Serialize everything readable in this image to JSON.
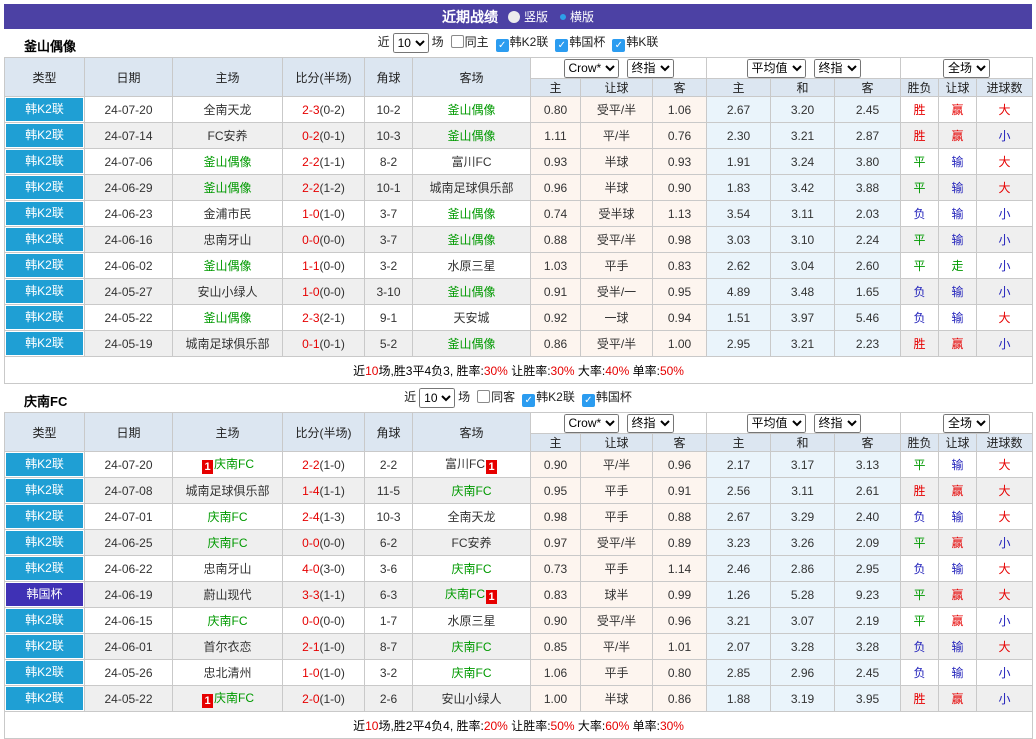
{
  "titlebar": {
    "title": "近期战绩",
    "radios": [
      {
        "label": "竖版",
        "selected": true
      },
      {
        "label": "横版",
        "selected": false
      }
    ]
  },
  "colors": {
    "titlebar_bg": "#4c41a4",
    "league_badge_bg": "#1f9fd4",
    "cup_badge_bg": "#3f31b5",
    "header_cell_bg": "#dce6f1",
    "handicap_cols_bg": "#fdf5ef",
    "average_cols_bg": "#eaf4fb",
    "score_red": "#e60000",
    "team_green": "#009a00",
    "win_red": "#e60000",
    "draw_green": "#009900",
    "lose_blue": "#2222bb"
  },
  "sections": [
    {
      "team": "釜山偶像",
      "filter": {
        "near_label": "近",
        "games_value": "10",
        "games_suffix": "场",
        "checkboxes": [
          {
            "label": "同主",
            "checked": false
          },
          {
            "label": "韩K2联",
            "checked": true
          },
          {
            "label": "韩国杯",
            "checked": true
          },
          {
            "label": "韩K联",
            "checked": true
          }
        ]
      },
      "header": {
        "left_cols": [
          "类型",
          "日期",
          "主场",
          "比分(半场)",
          "角球",
          "客场"
        ],
        "select_groups": [
          [
            "Crow*",
            "终指"
          ],
          [
            "平均值",
            "终指"
          ],
          [
            "全场"
          ]
        ],
        "sub_cols": [
          "主",
          "让球",
          "客",
          "主",
          "和",
          "客",
          "胜负",
          "让球",
          "进球数"
        ]
      },
      "rows": [
        {
          "type": "韩K2联",
          "style": "league",
          "date": "24-07-20",
          "home": {
            "text": "全南天龙"
          },
          "score": "2-3",
          "half": "(0-2)",
          "corner": "10-2",
          "away": {
            "text": "釜山偶像",
            "green": true
          },
          "odds": [
            "0.80",
            "受平/半",
            "1.06",
            "2.67",
            "3.20",
            "2.45"
          ],
          "results": [
            "胜",
            "赢",
            "大"
          ]
        },
        {
          "type": "韩K2联",
          "style": "league",
          "date": "24-07-14",
          "home": {
            "text": "FC安养"
          },
          "score": "0-2",
          "half": "(0-1)",
          "corner": "10-3",
          "away": {
            "text": "釜山偶像",
            "green": true
          },
          "odds": [
            "1.11",
            "平/半",
            "0.76",
            "2.30",
            "3.21",
            "2.87"
          ],
          "results": [
            "胜",
            "赢",
            "小"
          ]
        },
        {
          "type": "韩K2联",
          "style": "league",
          "date": "24-07-06",
          "home": {
            "text": "釜山偶像",
            "green": true
          },
          "score": "2-2",
          "half": "(1-1)",
          "corner": "8-2",
          "away": {
            "text": "富川FC"
          },
          "odds": [
            "0.93",
            "半球",
            "0.93",
            "1.91",
            "3.24",
            "3.80"
          ],
          "results": [
            "平",
            "输",
            "大"
          ]
        },
        {
          "type": "韩K2联",
          "style": "league",
          "date": "24-06-29",
          "home": {
            "text": "釜山偶像",
            "green": true
          },
          "score": "2-2",
          "half": "(1-2)",
          "corner": "10-1",
          "away": {
            "text": "城南足球俱乐部"
          },
          "odds": [
            "0.96",
            "半球",
            "0.90",
            "1.83",
            "3.42",
            "3.88"
          ],
          "results": [
            "平",
            "输",
            "大"
          ]
        },
        {
          "type": "韩K2联",
          "style": "league",
          "date": "24-06-23",
          "home": {
            "text": "金浦市民"
          },
          "score": "1-0",
          "half": "(1-0)",
          "corner": "3-7",
          "away": {
            "text": "釜山偶像",
            "green": true
          },
          "odds": [
            "0.74",
            "受半球",
            "1.13",
            "3.54",
            "3.11",
            "2.03"
          ],
          "results": [
            "负",
            "输",
            "小"
          ]
        },
        {
          "type": "韩K2联",
          "style": "league",
          "date": "24-06-16",
          "home": {
            "text": "忠南牙山"
          },
          "score": "0-0",
          "half": "(0-0)",
          "corner": "3-7",
          "away": {
            "text": "釜山偶像",
            "green": true
          },
          "odds": [
            "0.88",
            "受平/半",
            "0.98",
            "3.03",
            "3.10",
            "2.24"
          ],
          "results": [
            "平",
            "输",
            "小"
          ]
        },
        {
          "type": "韩K2联",
          "style": "league",
          "date": "24-06-02",
          "home": {
            "text": "釜山偶像",
            "green": true
          },
          "score": "1-1",
          "half": "(0-0)",
          "corner": "3-2",
          "away": {
            "text": "水原三星"
          },
          "odds": [
            "1.03",
            "平手",
            "0.83",
            "2.62",
            "3.04",
            "2.60"
          ],
          "results": [
            "平",
            "走",
            "小"
          ]
        },
        {
          "type": "韩K2联",
          "style": "league",
          "date": "24-05-27",
          "home": {
            "text": "安山小绿人"
          },
          "score": "1-0",
          "half": "(0-0)",
          "corner": "3-10",
          "away": {
            "text": "釜山偶像",
            "green": true
          },
          "odds": [
            "0.91",
            "受半/一",
            "0.95",
            "4.89",
            "3.48",
            "1.65"
          ],
          "results": [
            "负",
            "输",
            "小"
          ]
        },
        {
          "type": "韩K2联",
          "style": "league",
          "date": "24-05-22",
          "home": {
            "text": "釜山偶像",
            "green": true
          },
          "score": "2-3",
          "half": "(2-1)",
          "corner": "9-1",
          "away": {
            "text": "天安城"
          },
          "odds": [
            "0.92",
            "一球",
            "0.94",
            "1.51",
            "3.97",
            "5.46"
          ],
          "results": [
            "负",
            "输",
            "大"
          ]
        },
        {
          "type": "韩K2联",
          "style": "league",
          "date": "24-05-19",
          "home": {
            "text": "城南足球俱乐部"
          },
          "score": "0-1",
          "half": "(0-1)",
          "corner": "5-2",
          "away": {
            "text": "釜山偶像",
            "green": true
          },
          "odds": [
            "0.86",
            "受平/半",
            "1.00",
            "2.95",
            "3.21",
            "2.23"
          ],
          "results": [
            "胜",
            "赢",
            "小"
          ]
        }
      ],
      "summary": [
        {
          "t": "近"
        },
        {
          "t": "10",
          "c": "r"
        },
        {
          "t": "场,胜3平4负3, 胜率:"
        },
        {
          "t": "30%",
          "c": "r"
        },
        {
          "t": " 让胜率:"
        },
        {
          "t": "30%",
          "c": "r"
        },
        {
          "t": " 大率:"
        },
        {
          "t": "40%",
          "c": "r"
        },
        {
          "t": " 单率:"
        },
        {
          "t": "50%",
          "c": "r"
        }
      ]
    },
    {
      "team": "庆南FC",
      "filter": {
        "near_label": "近",
        "games_value": "10",
        "games_suffix": "场",
        "checkboxes": [
          {
            "label": "同客",
            "checked": false
          },
          {
            "label": "韩K2联",
            "checked": true
          },
          {
            "label": "韩国杯",
            "checked": true
          }
        ]
      },
      "header": {
        "left_cols": [
          "类型",
          "日期",
          "主场",
          "比分(半场)",
          "角球",
          "客场"
        ],
        "select_groups": [
          [
            "Crow*",
            "终指"
          ],
          [
            "平均值",
            "终指"
          ],
          [
            "全场"
          ]
        ],
        "sub_cols": [
          "主",
          "让球",
          "客",
          "主",
          "和",
          "客",
          "胜负",
          "让球",
          "进球数"
        ]
      },
      "rows": [
        {
          "type": "韩K2联",
          "style": "league",
          "date": "24-07-20",
          "home": {
            "text": "庆南FC",
            "green": true,
            "badge_pre": "1"
          },
          "score": "2-2",
          "half": "(1-0)",
          "corner": "2-2",
          "away": {
            "text": "富川FC",
            "badge_post": "1"
          },
          "odds": [
            "0.90",
            "平/半",
            "0.96",
            "2.17",
            "3.17",
            "3.13"
          ],
          "results": [
            "平",
            "输",
            "大"
          ]
        },
        {
          "type": "韩K2联",
          "style": "league",
          "date": "24-07-08",
          "home": {
            "text": "城南足球俱乐部"
          },
          "score": "1-4",
          "half": "(1-1)",
          "corner": "11-5",
          "away": {
            "text": "庆南FC",
            "green": true
          },
          "odds": [
            "0.95",
            "平手",
            "0.91",
            "2.56",
            "3.11",
            "2.61"
          ],
          "results": [
            "胜",
            "赢",
            "大"
          ]
        },
        {
          "type": "韩K2联",
          "style": "league",
          "date": "24-07-01",
          "home": {
            "text": "庆南FC",
            "green": true
          },
          "score": "2-4",
          "half": "(1-3)",
          "corner": "10-3",
          "away": {
            "text": "全南天龙"
          },
          "odds": [
            "0.98",
            "平手",
            "0.88",
            "2.67",
            "3.29",
            "2.40"
          ],
          "results": [
            "负",
            "输",
            "大"
          ]
        },
        {
          "type": "韩K2联",
          "style": "league",
          "date": "24-06-25",
          "home": {
            "text": "庆南FC",
            "green": true
          },
          "score": "0-0",
          "half": "(0-0)",
          "corner": "6-2",
          "away": {
            "text": "FC安养"
          },
          "odds": [
            "0.97",
            "受平/半",
            "0.89",
            "3.23",
            "3.26",
            "2.09"
          ],
          "results": [
            "平",
            "赢",
            "小"
          ]
        },
        {
          "type": "韩K2联",
          "style": "league",
          "date": "24-06-22",
          "home": {
            "text": "忠南牙山"
          },
          "score": "4-0",
          "half": "(3-0)",
          "corner": "3-6",
          "away": {
            "text": "庆南FC",
            "green": true
          },
          "odds": [
            "0.73",
            "平手",
            "1.14",
            "2.46",
            "2.86",
            "2.95"
          ],
          "results": [
            "负",
            "输",
            "大"
          ]
        },
        {
          "type": "韩国杯",
          "style": "cup",
          "date": "24-06-19",
          "home": {
            "text": "蔚山现代"
          },
          "score": "3-3",
          "half": "(1-1)",
          "corner": "6-3",
          "away": {
            "text": "庆南FC",
            "green": true,
            "badge_post": "1"
          },
          "odds": [
            "0.83",
            "球半",
            "0.99",
            "1.26",
            "5.28",
            "9.23"
          ],
          "results": [
            "平",
            "赢",
            "大"
          ]
        },
        {
          "type": "韩K2联",
          "style": "league",
          "date": "24-06-15",
          "home": {
            "text": "庆南FC",
            "green": true
          },
          "score": "0-0",
          "half": "(0-0)",
          "corner": "1-7",
          "away": {
            "text": "水原三星"
          },
          "odds": [
            "0.90",
            "受平/半",
            "0.96",
            "3.21",
            "3.07",
            "2.19"
          ],
          "results": [
            "平",
            "赢",
            "小"
          ]
        },
        {
          "type": "韩K2联",
          "style": "league",
          "date": "24-06-01",
          "home": {
            "text": "首尔衣恋"
          },
          "score": "2-1",
          "half": "(1-0)",
          "corner": "8-7",
          "away": {
            "text": "庆南FC",
            "green": true
          },
          "odds": [
            "0.85",
            "平/半",
            "1.01",
            "2.07",
            "3.28",
            "3.28"
          ],
          "results": [
            "负",
            "输",
            "大"
          ]
        },
        {
          "type": "韩K2联",
          "style": "league",
          "date": "24-05-26",
          "home": {
            "text": "忠北清州"
          },
          "score": "1-0",
          "half": "(1-0)",
          "corner": "3-2",
          "away": {
            "text": "庆南FC",
            "green": true
          },
          "odds": [
            "1.06",
            "平手",
            "0.80",
            "2.85",
            "2.96",
            "2.45"
          ],
          "results": [
            "负",
            "输",
            "小"
          ]
        },
        {
          "type": "韩K2联",
          "style": "league",
          "date": "24-05-22",
          "home": {
            "text": "庆南FC",
            "green": true,
            "badge_pre": "1"
          },
          "score": "2-0",
          "half": "(1-0)",
          "corner": "2-6",
          "away": {
            "text": "安山小绿人"
          },
          "odds": [
            "1.00",
            "半球",
            "0.86",
            "1.88",
            "3.19",
            "3.95"
          ],
          "results": [
            "胜",
            "赢",
            "小"
          ]
        }
      ],
      "summary": [
        {
          "t": "近"
        },
        {
          "t": "10",
          "c": "r"
        },
        {
          "t": "场,胜2平4负4, 胜率:"
        },
        {
          "t": "20%",
          "c": "r"
        },
        {
          "t": " 让胜率:"
        },
        {
          "t": "50%",
          "c": "r"
        },
        {
          "t": " 大率:"
        },
        {
          "t": "60%",
          "c": "r"
        },
        {
          "t": " 单率:"
        },
        {
          "t": "30%",
          "c": "r"
        }
      ]
    }
  ]
}
